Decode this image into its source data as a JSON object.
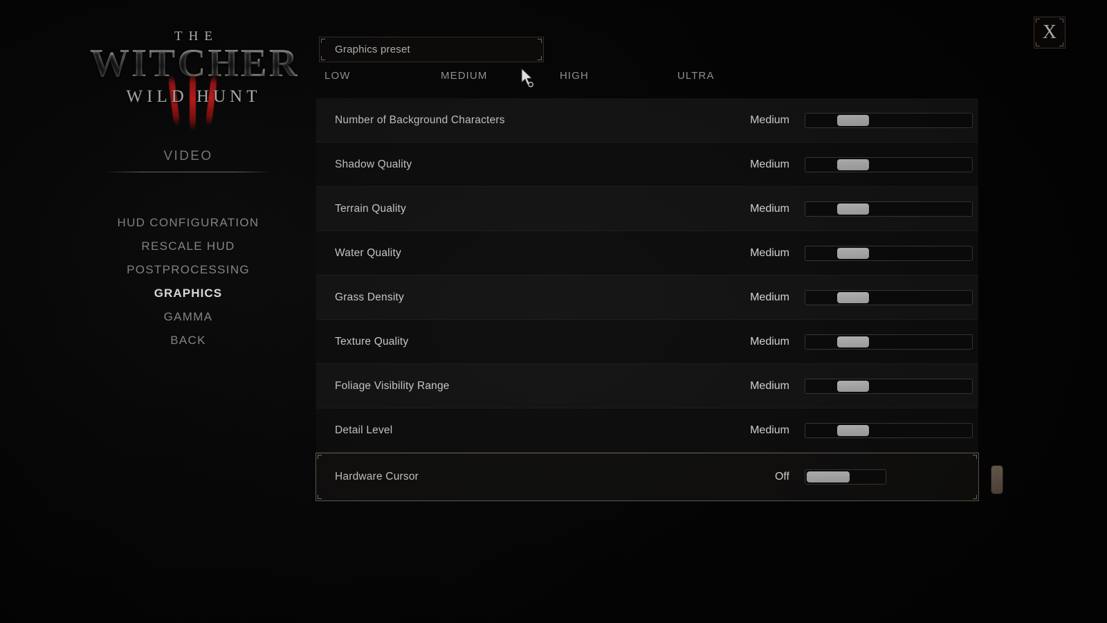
{
  "game": {
    "logo_the": "THE",
    "logo_title": "WITCHER",
    "logo_subtitle": "WILD HUNT"
  },
  "sidebar": {
    "section_title": "VIDEO",
    "items": [
      {
        "label": "HUD CONFIGURATION",
        "active": false
      },
      {
        "label": "RESCALE HUD",
        "active": false
      },
      {
        "label": "POSTPROCESSING",
        "active": false
      },
      {
        "label": "GRAPHICS",
        "active": true
      },
      {
        "label": "GAMMA",
        "active": false
      },
      {
        "label": "BACK",
        "active": false
      }
    ]
  },
  "header": {
    "preset_label": "Graphics preset",
    "preset_ticks": [
      "LOW",
      "MEDIUM",
      "HIGH",
      "ULTRA"
    ],
    "close_label": "X",
    "close_icon": "close-icon"
  },
  "settings": {
    "rows": [
      {
        "name": "Number of Background Characters",
        "value": "Medium",
        "slider_pct": 30,
        "selected": false
      },
      {
        "name": "Shadow Quality",
        "value": "Medium",
        "slider_pct": 30,
        "selected": false
      },
      {
        "name": "Terrain Quality",
        "value": "Medium",
        "slider_pct": 30,
        "selected": false
      },
      {
        "name": "Water Quality",
        "value": "Medium",
        "slider_pct": 30,
        "selected": false
      },
      {
        "name": "Grass Density",
        "value": "Medium",
        "slider_pct": 30,
        "selected": false
      },
      {
        "name": "Texture Quality",
        "value": "Medium",
        "slider_pct": 30,
        "selected": false
      },
      {
        "name": "Foliage Visibility Range",
        "value": "Medium",
        "slider_pct": 30,
        "selected": false
      },
      {
        "name": "Detail Level",
        "value": "Medium",
        "slider_pct": 30,
        "selected": false
      },
      {
        "name": "Hardware Cursor",
        "value": "Off",
        "slider_pct": 0,
        "selected": true
      }
    ]
  },
  "scrollbar": {
    "position": "bottom"
  },
  "colors": {
    "background": "#000000",
    "row_even": "#141414",
    "row_odd": "#0d0d0d",
    "selected_border": "#6f6257",
    "slider_thumb": "#b8b8b8",
    "scroll_thumb": "#6b5a4d",
    "text_primary": "#d6d6d6",
    "text_muted": "#9a9a9a",
    "accent_red": "#c01818"
  }
}
